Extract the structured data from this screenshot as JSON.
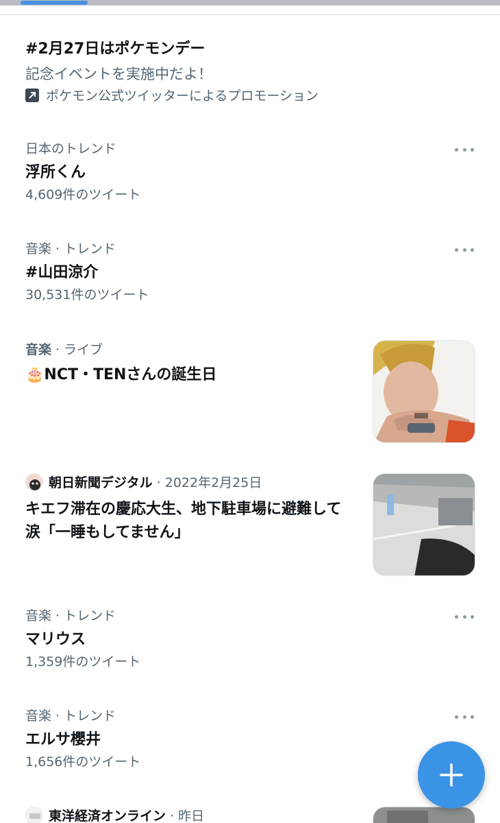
{
  "promo": {
    "title": "#2月27日はポケモンデー",
    "description": "記念イベントを実施中だよ！",
    "promoted_by": "ポケモン公式ツイッターによるプロモーション"
  },
  "trends": [
    {
      "context": "日本のトレンド",
      "name": "浮所くん",
      "count": "4,609件のツイート"
    },
    {
      "context": "音楽 · トレンド",
      "name": "#山田涼介",
      "count": "30,531件のツイート"
    },
    {
      "context": "音楽 · トレンド",
      "name": "マリウス",
      "count": "1,359件のツイート"
    },
    {
      "context": "音楽 · トレンド",
      "name": "エルサ櫻井",
      "count": "1,656件のツイート"
    }
  ],
  "live": {
    "category": "音楽",
    "separator": " · ",
    "tag": "ライブ",
    "emoji": "🎂",
    "title": "NCT・TENさんの誕生日"
  },
  "news": [
    {
      "source": "朝日新聞デジタル",
      "date": " · 2022年2月25日",
      "headline": "キエフ滞在の慶応大生、地下駐車場に避難して涙「一睡もしてません」"
    },
    {
      "source": "東洋経済オンライン",
      "date": " · 昨日"
    }
  ],
  "colors": {
    "accent": "#3b93e6",
    "secondary_text": "#536471",
    "primary_text": "#0f1419"
  }
}
